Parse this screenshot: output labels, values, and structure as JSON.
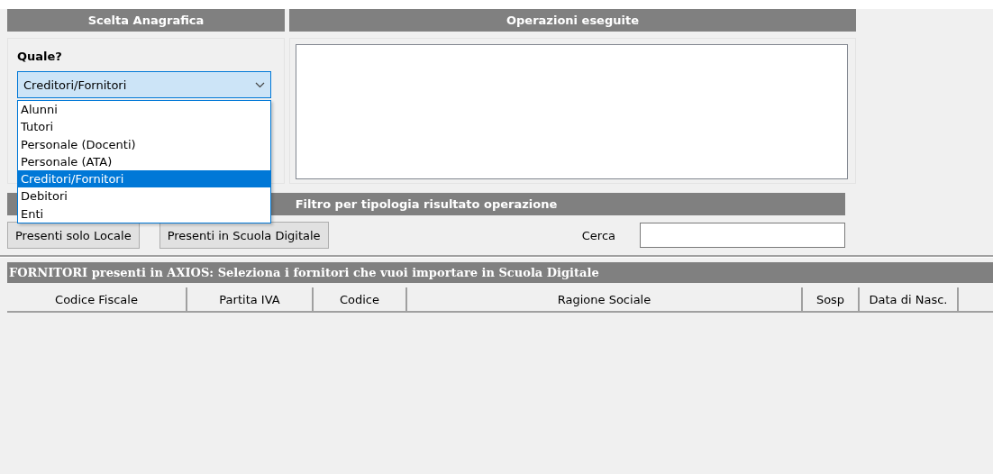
{
  "anagrafica": {
    "title": "Scelta Anagrafica",
    "label": "Quale?",
    "value": "Creditori/Fornitori",
    "expanded": true,
    "options": [
      {
        "label": "Alunni",
        "selected": false
      },
      {
        "label": "Tutori",
        "selected": false
      },
      {
        "label": "Personale (Docenti)",
        "selected": false
      },
      {
        "label": "Personale (ATA)",
        "selected": false
      },
      {
        "label": "Creditori/Fornitori",
        "selected": true
      },
      {
        "label": "Debitori",
        "selected": false
      },
      {
        "label": "Enti",
        "selected": false
      }
    ]
  },
  "operazioni": {
    "title": "Operazioni eseguite"
  },
  "filtro": {
    "title": "Filtro per tipologia risultato operazione",
    "buttons": [
      "Presenti solo Locale",
      "Presenti in Scuola Digitale"
    ],
    "search_label": "Cerca"
  },
  "table": {
    "title": "FORNITORI presenti in AXIOS: Seleziona i fornitori che vuoi importare in Scuola Digitale",
    "columns": [
      "Codice Fiscale",
      "Partita IVA",
      "Codice",
      "Ragione Sociale",
      "Sosp",
      "Data di Nasc."
    ]
  }
}
